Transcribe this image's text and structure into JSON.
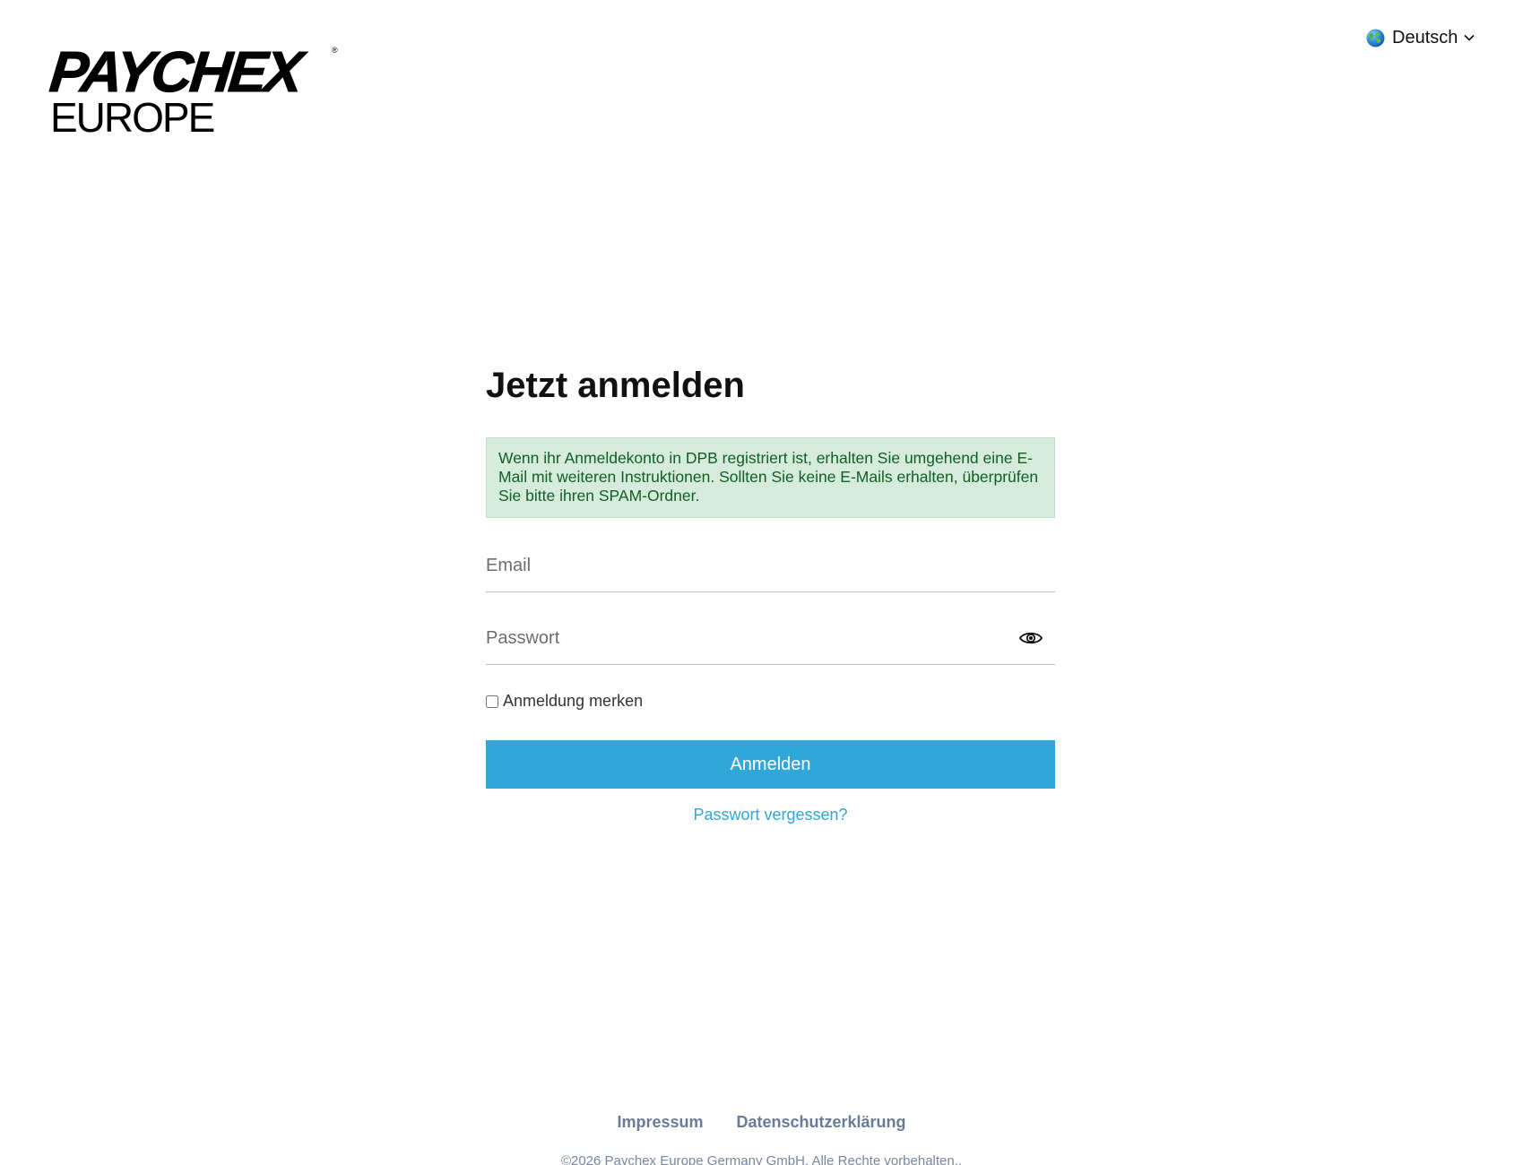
{
  "logo": {
    "top": "PAYCHEX",
    "registered": "®",
    "bottom": "EUROPE"
  },
  "language": {
    "label": "Deutsch",
    "icon": "globe-icon"
  },
  "login": {
    "title": "Jetzt anmelden",
    "alert": "Wenn ihr Anmeldekonto in DPB registriert ist, erhalten Sie umgehend eine E-Mail mit weiteren Instruktionen. Sollten Sie keine E-Mails erhalten, überprüfen Sie bitte ihren SPAM-Ordner.",
    "email_placeholder": "Email",
    "email_value": "",
    "password_placeholder": "Passwort",
    "password_value": "",
    "remember_label": "Anmeldung merken",
    "remember_checked": false,
    "submit_label": "Anmelden",
    "forgot_label": "Passwort vergessen?"
  },
  "footer": {
    "links": [
      "Impressum",
      "Datenschutzerklärung"
    ],
    "copyright": "©2026 Paychex Europe Germany GmbH. Alle Rechte vorbehalten.."
  },
  "colors": {
    "accent": "#31a6d8",
    "alert_bg": "#d5ecdc",
    "alert_text": "#145d26",
    "footer_link": "#6c7b95"
  }
}
